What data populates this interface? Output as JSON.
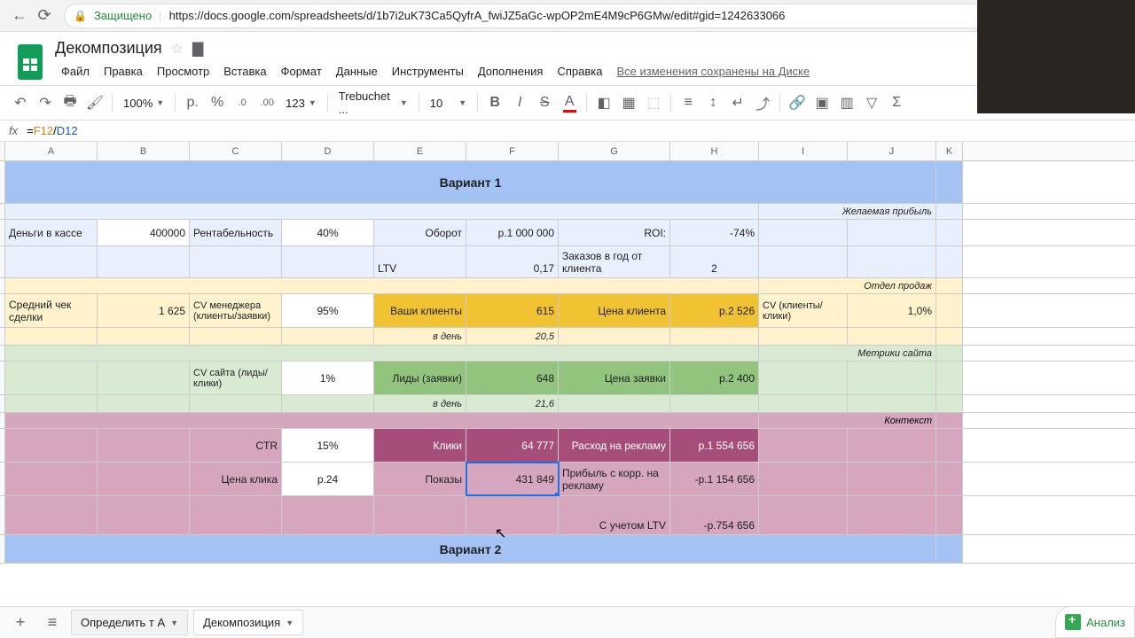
{
  "browser": {
    "secure_label": "Защищено",
    "url": "https://docs.google.com/spreadsheets/d/1b7i2uK73Ca5QyfrA_fwiJZ5aGc-wpOP2mE4M9cP6GMw/edit#gid=1242633066"
  },
  "doc": {
    "title": "Декомпозиция",
    "saved": "Все изменения сохранены на Диске"
  },
  "menus": {
    "file": "Файл",
    "edit": "Правка",
    "view": "Просмотр",
    "insert": "Вставка",
    "format": "Формат",
    "data": "Данные",
    "tools": "Инструменты",
    "addons": "Дополнения",
    "help": "Справка"
  },
  "toolbar": {
    "zoom": "100%",
    "currency": "р.",
    "percent": "%",
    "dec_dec": ".0",
    "inc_dec": ".00",
    "format123": "123",
    "font": "Trebuchet ...",
    "font_size": "10"
  },
  "formula": {
    "eq": "=",
    "ref1": "F12",
    "op": "/",
    "ref2": "D12"
  },
  "cols": {
    "A": "A",
    "B": "B",
    "C": "C",
    "D": "D",
    "E": "E",
    "F": "F",
    "G": "G",
    "H": "H",
    "I": "I",
    "J": "J",
    "K": "K"
  },
  "sheet": {
    "variant1": "Вариант 1",
    "variant2": "Вариант 2",
    "r2": {
      "j": "Желаемая прибыль"
    },
    "r3": {
      "a": "Деньги в кассе",
      "b": "400000",
      "c": "Рентабельность",
      "d": "40%",
      "e": "Оборот",
      "f": "р.1 000 000",
      "g": "ROI:",
      "h": "-74%"
    },
    "r4": {
      "e": "LTV",
      "f": "0,17",
      "g": "Заказов в год от клиента",
      "h": "2"
    },
    "r5": {
      "j": "Отдел продаж"
    },
    "r6": {
      "a": "Средний чек сделки",
      "b": "1 625",
      "c": "CV менеджера (клиенты/заявки)",
      "d": "95%",
      "e": "Ваши клиенты",
      "f": "615",
      "g": "Цена клиента",
      "h": "р.2 526",
      "i": "CV (клиенты/ клики)",
      "j": "1,0%"
    },
    "r7": {
      "e": "в день",
      "f": "20,5"
    },
    "r8": {
      "j": "Метрики сайта"
    },
    "r9": {
      "c": "CV сайта (лиды/клики)",
      "d": "1%",
      "e": "Лиды (заявки)",
      "f": "648",
      "g": "Цена заявки",
      "h": "р.2 400"
    },
    "r10": {
      "e": "в день",
      "f": "21,6"
    },
    "r11": {
      "j": "Контекст"
    },
    "r12": {
      "c": "CTR",
      "d": "15%",
      "e": "Клики",
      "f": "64 777",
      "g": "Расход на рекламу",
      "h": "р.1 554 656"
    },
    "r13": {
      "c": "Цена клика",
      "d": "р.24",
      "e": "Показы",
      "f": "431 849",
      "g": "Прибыль с корр. на рекламу",
      "h": "-р.1 154 656"
    },
    "r14": {
      "g": "С учетом LTV",
      "h": "-р.754 656"
    }
  },
  "tabs": {
    "tab1": "Определить т А",
    "tab2": "Декомпозиция"
  },
  "explore": "Анализ"
}
